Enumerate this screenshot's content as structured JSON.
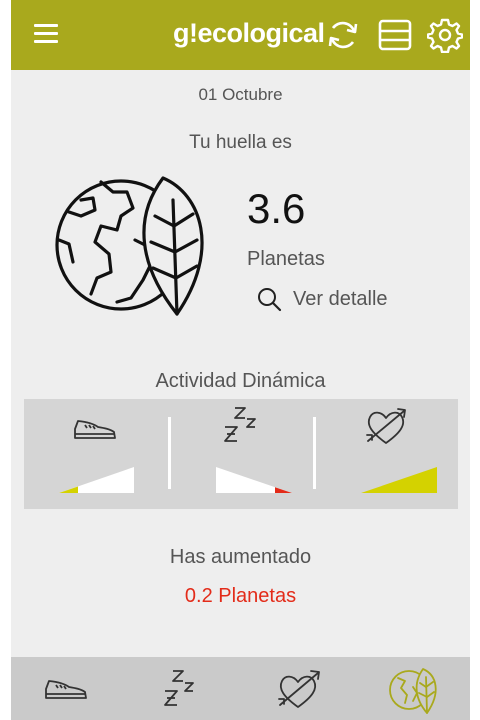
{
  "header": {
    "brand": "g!ecological",
    "menu_icon": "hamburger-menu-icon",
    "sync_icon": "sync-icon",
    "layout_icon": "layout-icon",
    "settings_icon": "gear-icon",
    "bg_color": "#a9a91d"
  },
  "summary": {
    "date": "01 Octubre",
    "title": "Tu huella es",
    "value": "3.6",
    "unit": "Planetas",
    "detail_label": "Ver detalle"
  },
  "activity": {
    "title": "Actividad Dinámica",
    "items": [
      {
        "name": "Caminar",
        "icon": "sneaker-icon",
        "level": 0.25,
        "level_color": "#d4d200"
      },
      {
        "name": "Dormir",
        "icon": "sleep-zzz-icon",
        "level": 0.2,
        "level_color": "#e32b19"
      },
      {
        "name": "Amor",
        "icon": "heart-arrow-icon",
        "level": 1.0,
        "level_color": "#d4d200"
      }
    ]
  },
  "change": {
    "title": "Has aumentado",
    "value": "0.2 Planetas",
    "color": "#e32b19"
  },
  "bottom_nav": {
    "items": [
      "sneaker-icon",
      "sleep-zzz-icon",
      "heart-arrow-icon",
      "earth-leaf-icon"
    ],
    "active": "earth-leaf-icon"
  }
}
